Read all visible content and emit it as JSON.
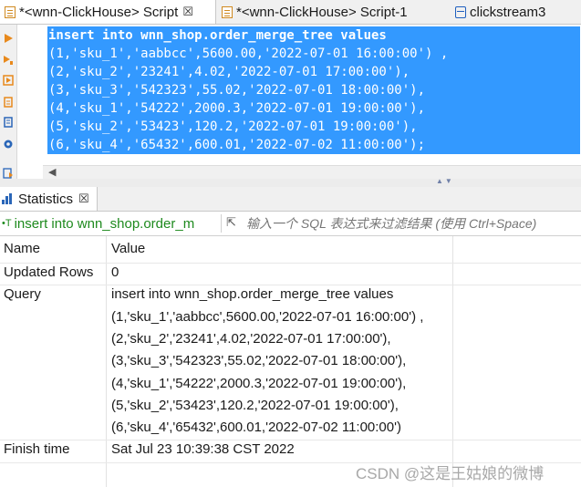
{
  "tabs": [
    {
      "label": "*<wnn-ClickHouse> Script",
      "close": "☒",
      "icon": "sql-script-icon",
      "active": true
    },
    {
      "label": "*<wnn-ClickHouse> Script-1",
      "close": "",
      "icon": "sql-script-icon",
      "active": false
    },
    {
      "label": "clickstream3",
      "close": "",
      "icon": "database-table-icon",
      "active": false
    }
  ],
  "editor": {
    "lines": [
      "insert into wnn_shop.order_merge_tree values",
      "(1,'sku_1','aabbcc',5600.00,'2022-07-01 16:00:00') ,",
      "(2,'sku_2','23241',4.02,'2022-07-01 17:00:00'),",
      "(3,'sku_3','542323',55.02,'2022-07-01 18:00:00'),",
      "(4,'sku_1','54222',2000.3,'2022-07-01 19:00:00'),",
      "(5,'sku_2','53423',120.2,'2022-07-01 19:00:00'),",
      "(6,'sku_4','65432',600.01,'2022-07-02 11:00:00');"
    ],
    "selection_color": "#3399ff"
  },
  "results": {
    "tab_label": "Statistics",
    "tab_close": "☒",
    "query_label": "insert into wnn_shop.order_m",
    "filter_placeholder": "输入一个 SQL 表达式来过滤结果 (使用 Ctrl+Space)",
    "columns": [
      "Name",
      "Value"
    ],
    "rows": [
      {
        "name": "Updated Rows",
        "value": "0"
      },
      {
        "name": "Query",
        "value": "insert into wnn_shop.order_merge_tree values"
      },
      {
        "name": "",
        "value": "(1,'sku_1','aabbcc',5600.00,'2022-07-01 16:00:00') ,"
      },
      {
        "name": "",
        "value": "(2,'sku_2','23241',4.02,'2022-07-01 17:00:00'),"
      },
      {
        "name": "",
        "value": "(3,'sku_3','542323',55.02,'2022-07-01 18:00:00'),"
      },
      {
        "name": "",
        "value": "(4,'sku_1','54222',2000.3,'2022-07-01 19:00:00'),"
      },
      {
        "name": "",
        "value": "(5,'sku_2','53423',120.2,'2022-07-01 19:00:00'),"
      },
      {
        "name": "",
        "value": "(6,'sku_4','65432',600.01,'2022-07-02 11:00:00')"
      },
      {
        "name": "Finish time",
        "value": "Sat Jul 23 10:39:38 CST 2022"
      }
    ]
  },
  "watermark": "CSDN @这是王姑娘的微博",
  "colors": {
    "accent": "#3399ff",
    "query_label": "#1e8a1e",
    "toolbar_icon": "#e8891c"
  }
}
